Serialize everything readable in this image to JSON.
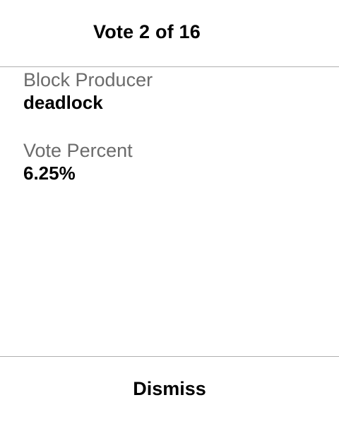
{
  "header": {
    "title": "Vote 2 of 16"
  },
  "vote": {
    "producer_label": "Block Producer",
    "producer_value": "deadlock",
    "percent_label": "Vote Percent",
    "percent_value": "6.25%"
  },
  "footer": {
    "dismiss_label": "Dismiss"
  }
}
